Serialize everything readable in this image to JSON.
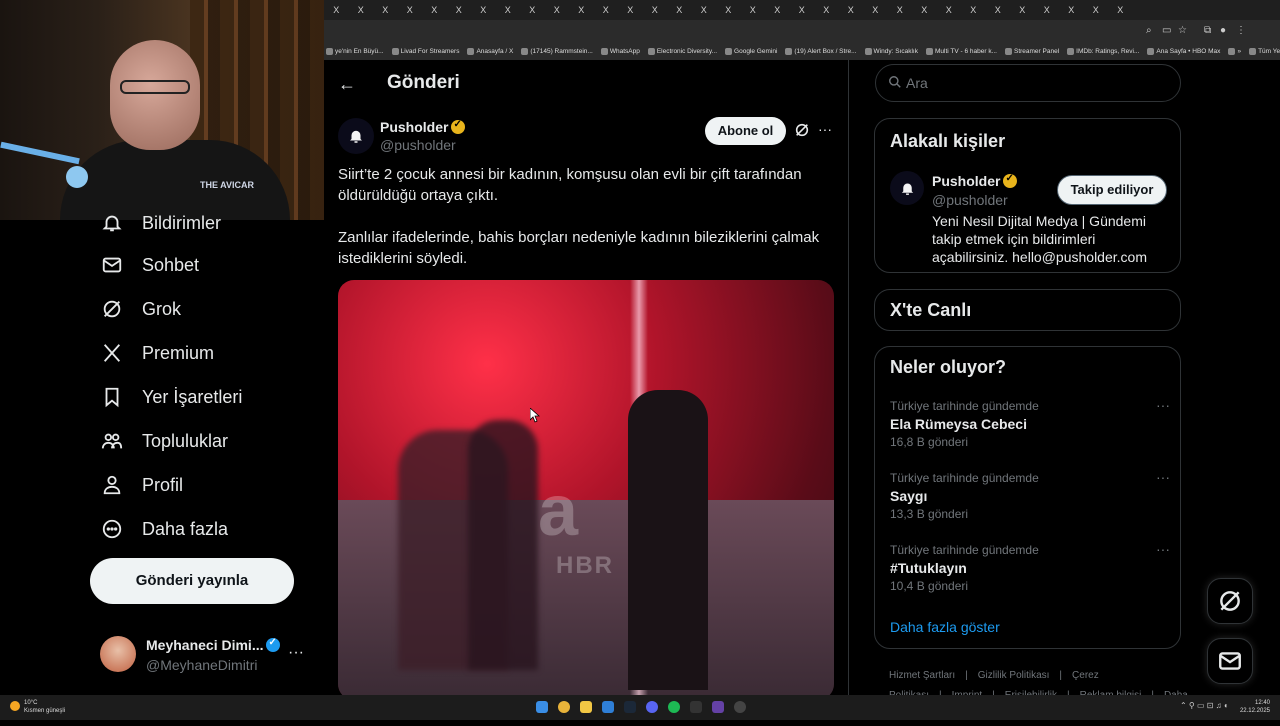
{
  "browser": {
    "tab_glyph": "X",
    "tab_count": 33,
    "bookmarks": [
      "ye'nin En Büyü...",
      "Livad For Streamers",
      "Anasayfa / X",
      "(17145) Rammstein...",
      "WhatsApp",
      "Electronic Diversity...",
      "Google Gemini",
      "(19) Alert Box / Stre...",
      "Windy: Sıcaklık",
      "Multi TV - 6 haber k...",
      "Streamer Panel",
      "IMDb: Ratings, Revi...",
      "Ana Sayfa • HBO Max",
      "»",
      "Tüm Yer İşaretleri"
    ]
  },
  "webcam": {
    "logo_text": "THE AVICAR"
  },
  "nav": {
    "items": [
      {
        "label": "Bildirimler",
        "icon": "bell-icon"
      },
      {
        "label": "Sohbet",
        "icon": "mail-icon"
      },
      {
        "label": "Grok",
        "icon": "grok-icon"
      },
      {
        "label": "Premium",
        "icon": "x-logo-icon"
      },
      {
        "label": "Yer İşaretleri",
        "icon": "bookmark-icon"
      },
      {
        "label": "Topluluklar",
        "icon": "communities-icon"
      },
      {
        "label": "Profil",
        "icon": "profile-icon"
      },
      {
        "label": "Daha fazla",
        "icon": "more-circle-icon"
      }
    ],
    "post_button": "Gönderi yayınla",
    "user": {
      "name": "Meyhaneci Dimi...",
      "handle": "@MeyhaneDimitri",
      "more": "···"
    }
  },
  "main": {
    "back_icon": "←",
    "title": "Gönderi",
    "account": {
      "name": "Pusholder",
      "handle": "@pusholder"
    },
    "subscribe_button": "Abone ol",
    "more": "···",
    "text_1": "Siirt’te 2 çocuk annesi bir kadının, komşusu olan evli bir çift tarafından öldürüldüğü ortaya çıktı.",
    "text_2": "Zanlılar ifadelerinde, bahis borçları nedeniyle kadının bileziklerini çalmak istediklerini söyledi.",
    "media_watermark": "a",
    "media_watermark_sub": "HBR"
  },
  "right": {
    "search_placeholder": "Ara",
    "related": {
      "title": "Alakalı kişiler",
      "name": "Pusholder",
      "handle": "@pusholder",
      "follow_button": "Takip ediliyor",
      "bio": "Yeni Nesil Dijital Medya | Gündemi takip etmek için bildirimleri açabilirsiniz. hello@pusholder.com"
    },
    "live_title": "X'te Canlı",
    "trends_title": "Neler oluyor?",
    "trends": [
      {
        "context": "Türkiye tarihinde gündemde",
        "topic": "Ela Rümeysa Cebeci",
        "count": "16,8 B gönderi"
      },
      {
        "context": "Türkiye tarihinde gündemde",
        "topic": "Saygı",
        "count": "13,3 B gönderi"
      },
      {
        "context": "Türkiye tarihinde gündemde",
        "topic": "#Tutuklayın",
        "count": "10,4 B gönderi"
      }
    ],
    "trend_more": "···",
    "show_more": "Daha fazla göster",
    "footer": [
      "Hizmet Şartları",
      "|",
      "Gizlilik Politikası",
      "|",
      "Çerez Politikası",
      "|",
      "Imprint",
      "|",
      "Erişilebilirlik",
      "|",
      "Reklam bilgisi",
      "|",
      "Daha fazla ..."
    ]
  },
  "taskbar": {
    "weather_temp": "10°C",
    "weather_desc": "Kısmen güneşli",
    "time": "12:40",
    "date": "22.12.2025"
  },
  "colors": {
    "accent": "#1d9bf0",
    "verified_gold": "#e8b41c",
    "border": "#2f3336",
    "muted": "#71767b"
  }
}
